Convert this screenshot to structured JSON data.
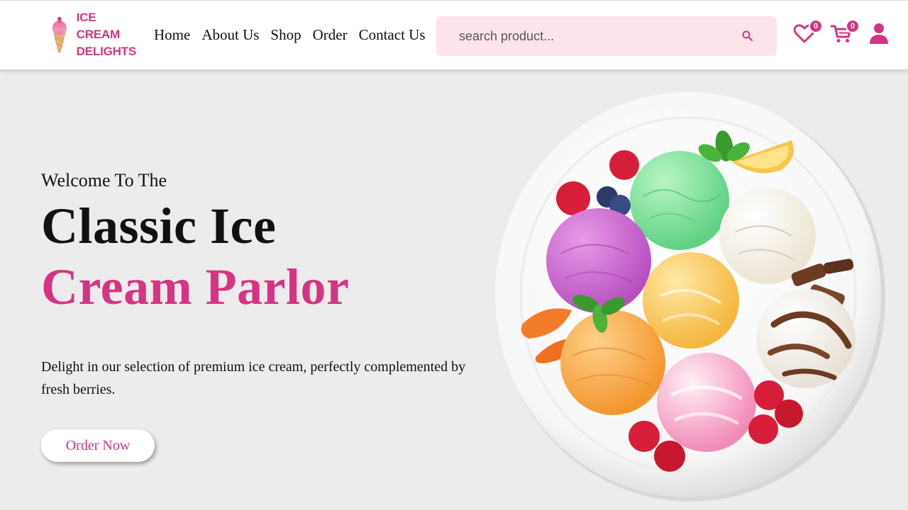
{
  "colors": {
    "accent": "#d63384",
    "search_bg": "#fde4ea",
    "page_bg": "#ececec"
  },
  "logo": {
    "line1": "ICE CREAM",
    "line2": "DELIGHTS",
    "icon": "ice-cream-cone-icon"
  },
  "nav": {
    "items": [
      "Home",
      "About Us",
      "Shop",
      "Order",
      "Contact Us"
    ]
  },
  "search": {
    "placeholder": "search product...",
    "value": "",
    "icon": "search-icon"
  },
  "header_icons": {
    "wishlist": {
      "icon": "heart-icon",
      "count": "0"
    },
    "cart": {
      "icon": "cart-icon",
      "count": "0"
    },
    "user": {
      "icon": "user-icon"
    }
  },
  "hero": {
    "welcome": "Welcome To The",
    "title_line1": "Classic Ice",
    "title_line2": "Cream Parlor",
    "description": "Delight in our selection of premium ice cream, perfectly complemented by fresh berries.",
    "button_label": "Order Now",
    "image": "ice-cream-plate-image"
  }
}
